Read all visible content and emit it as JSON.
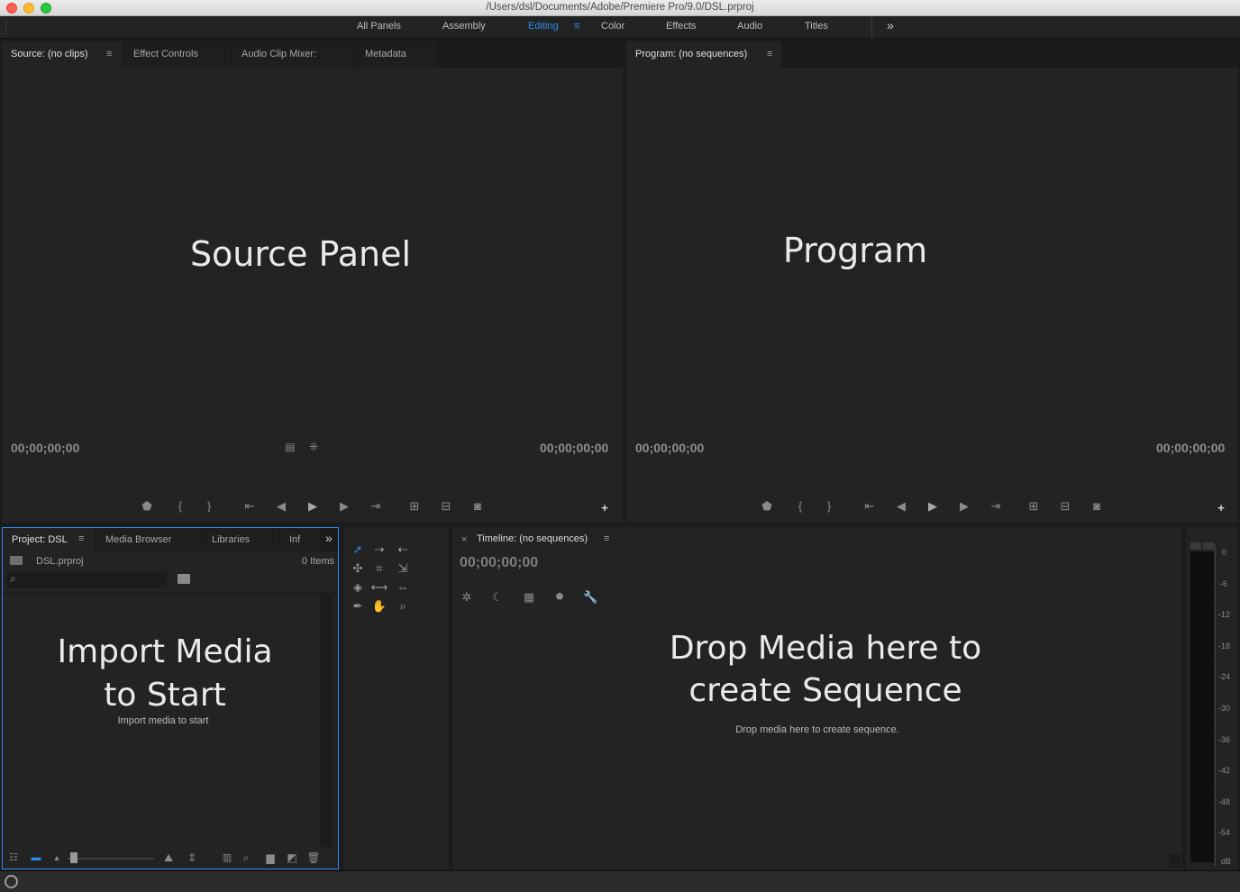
{
  "window": {
    "title": "/Users/dsl/Documents/Adobe/Premiere Pro/9.0/DSL.prproj",
    "traffic_lights": {
      "close": "#fc5f57",
      "minimize": "#fdbc2e",
      "zoom": "#28c840"
    }
  },
  "workspace": {
    "tabs": [
      "All Panels",
      "Assembly",
      "Editing",
      "Color",
      "Effects",
      "Audio",
      "Titles"
    ],
    "active": "Editing",
    "menu_icon": "≡",
    "overflow_icon": "»",
    "accent": "#2d8ceb"
  },
  "source": {
    "tabs": [
      "Source: (no clips)",
      "Effect Controls",
      "Audio Clip Mixer:",
      "Metadata"
    ],
    "menu_icon": "≡",
    "overlay": "Source Panel",
    "timecode_left": "00;00;00;00",
    "timecode_right": "00;00;00;00"
  },
  "program": {
    "tab": "Program: (no sequences)",
    "menu_icon": "≡",
    "overlay": "Program",
    "timecode_left": "00;00;00;00",
    "timecode_right": "00;00;00;00"
  },
  "project": {
    "tabs": [
      "Project: DSL",
      "Media Browser",
      "Libraries",
      "Inf"
    ],
    "menu_icon": "≡",
    "overflow_icon": "»",
    "file": "DSL.prproj",
    "items": "0 Items",
    "search_placeholder": "",
    "overlay_line1": "Import Media",
    "overlay_line2": "to Start",
    "hint": "Import media to start"
  },
  "timeline": {
    "close_icon": "×",
    "tab": "Timeline: (no sequences)",
    "menu_icon": "≡",
    "timecode": "00;00;00;00",
    "overlay_line1": "Drop Media here to",
    "overlay_line2": "create Sequence",
    "hint": "Drop media here to create sequence."
  },
  "audio_meter": {
    "scale": [
      "0",
      "-6",
      "-12",
      "-18",
      "-24",
      "-30",
      "-36",
      "-42",
      "-48",
      "-54",
      "dB"
    ]
  },
  "icons": {
    "marker": "marker-icon",
    "mark_in": "mark-in-icon",
    "mark_out": "mark-out-icon",
    "go_to_in": "go-to-in-icon",
    "step_back": "step-back-icon",
    "play": "play-icon",
    "step_forward": "step-forward-icon",
    "go_to_out": "go-to-out-icon",
    "insert": "insert-icon",
    "overwrite": "overwrite-icon",
    "export_frame": "camera-icon",
    "add": "plus-icon"
  }
}
